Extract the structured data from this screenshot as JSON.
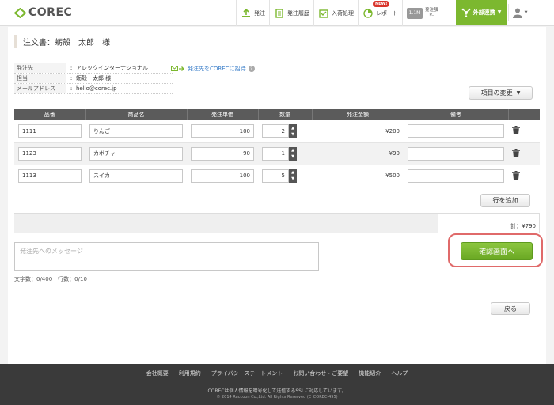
{
  "app": {
    "logo": "COREC",
    "brand_color": "#7cb82f"
  },
  "nav": [
    {
      "label": "発注",
      "icon": "order-icon"
    },
    {
      "label": "発注履歴",
      "icon": "history-icon"
    },
    {
      "label": "入荷処理",
      "icon": "receive-icon"
    },
    {
      "label": "レポート",
      "icon": "report-icon",
      "badge": "NEW!"
    }
  ],
  "rank": {
    "box": "1.1M",
    "line1": "発注額",
    "line2": "¥-"
  },
  "ext_link": {
    "label": "外部連携"
  },
  "page": {
    "title": "注文書：蛎殻　太郎　様",
    "info": [
      {
        "key": "発注先",
        "value": "アレックインターナショナル"
      },
      {
        "key": "担当",
        "value": "蛎殻　太郎 様"
      },
      {
        "key": "メールアドレス",
        "value": "hello@corec.jp"
      }
    ],
    "invite_label": "発注先をCORECに招待",
    "change_items_label": "項目の変更",
    "add_row_label": "行を追加",
    "total_label": "計：¥790",
    "message_placeholder": "発注先へのメッセージ",
    "counter": "文字数：0/400　行数：0/10",
    "confirm_label": "確認画面へ",
    "back_label": "戻る"
  },
  "table": {
    "headers": [
      "品番",
      "商品名",
      "発注単価",
      "数量",
      "発注金額",
      "備考",
      ""
    ],
    "rows": [
      {
        "code": "1111",
        "name": "りんご",
        "price": "100",
        "qty": "2",
        "amount": "¥200",
        "note": ""
      },
      {
        "code": "1123",
        "name": "カボチャ",
        "price": "90",
        "qty": "1",
        "amount": "¥90",
        "note": ""
      },
      {
        "code": "1113",
        "name": "スイカ",
        "price": "100",
        "qty": "5",
        "amount": "¥500",
        "note": ""
      }
    ]
  },
  "footer": {
    "links": [
      "会社概要",
      "利用規約",
      "プライバシーステートメント",
      "お問い合わせ・ご要望",
      "機能紹介",
      "ヘルプ"
    ],
    "note": "CORECは個人情報を暗号化して送信するSSLに対応しています。",
    "copyright": "© 2014 Raccoon Co.,Ltd. All Rights Reserved (C_COREC-495)"
  }
}
